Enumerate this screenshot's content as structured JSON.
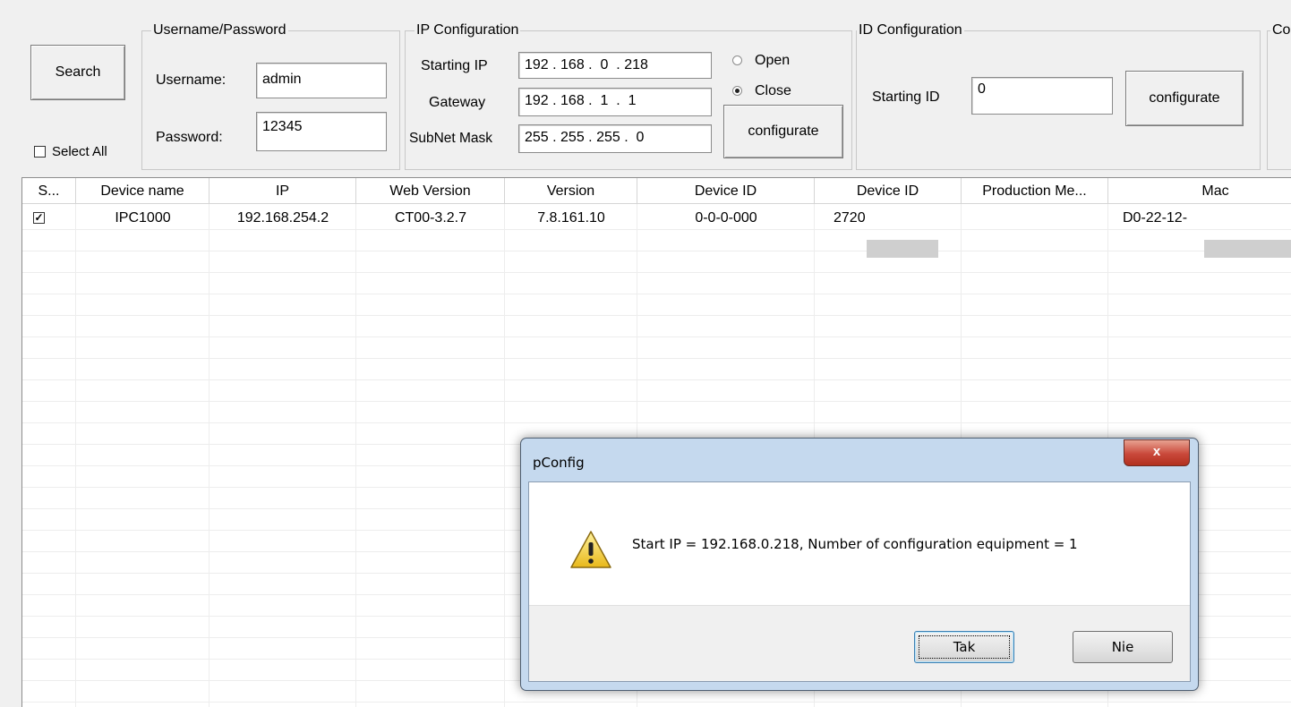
{
  "toolbar": {
    "search_label": "Search",
    "select_all_label": "Select All",
    "select_all_checked": false
  },
  "credentials": {
    "legend": "Username/Password",
    "username_label": "Username:",
    "username_value": "admin",
    "password_label": "Password:",
    "password_value": "12345"
  },
  "ip_config": {
    "legend": "IP Configuration",
    "starting_ip_label": "Starting IP",
    "starting_ip_value": "192 . 168 .  0  . 218",
    "gateway_label": "Gateway",
    "gateway_value": "192 . 168 .  1  .  1",
    "subnet_label": "SubNet Mask",
    "subnet_value": "255 . 255 . 255 .  0",
    "radio_open_label": "Open",
    "radio_close_label": "Close",
    "selected": "Close",
    "configurate_label": "configurate"
  },
  "id_config": {
    "legend": "ID Configuration",
    "starting_id_label": "Starting ID",
    "starting_id_value": "0",
    "configurate_label": "configurate"
  },
  "partial_group_legend": "Co",
  "table": {
    "columns": [
      "S...",
      "Device name",
      "IP",
      "Web Version",
      "Version",
      "Device ID",
      "Device ID",
      "Production Me...",
      "Mac"
    ],
    "rows": [
      {
        "selected": true,
        "device_name": "IPC1000",
        "ip": "192.168.254.2",
        "web_version": "CT00-3.2.7",
        "version": "7.8.161.10",
        "device_id": "0-0-0-000",
        "device_id_2": "2720",
        "production": "",
        "mac": "D0-22-12-"
      }
    ]
  },
  "dialog": {
    "title": "pConfig",
    "close_glyph": "x",
    "message": "Start IP = 192.168.0.218, Number of configuration equipment = 1",
    "yes_label": "Tak",
    "no_label": "Nie",
    "icon": "warning-icon"
  }
}
